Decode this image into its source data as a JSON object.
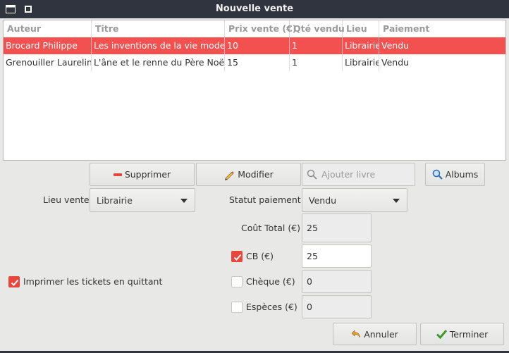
{
  "window": {
    "title": "Nouvelle vente"
  },
  "table": {
    "columns": [
      "Auteur",
      "Titre",
      "Prix vente (€)",
      "Qté vendu",
      "Lieu",
      "Paiement"
    ],
    "rows": [
      {
        "auteur": "Brocard Philippe",
        "titre": "Les inventions de la vie moderne",
        "prix": "10",
        "qte": "1",
        "lieu": "Librairie",
        "paiement": "Vendu",
        "selected": true
      },
      {
        "auteur": "Grenouiller Laureline",
        "titre": "L'âne et le renne du Père Noël",
        "prix": "15",
        "qte": "1",
        "lieu": "Librairie",
        "paiement": "Vendu",
        "selected": false
      }
    ]
  },
  "actions": {
    "supprimer": "Supprimer",
    "modifier": "Modifier",
    "search_placeholder": "Ajouter livre",
    "albums": "Albums"
  },
  "form": {
    "lieu_label": "Lieu vente",
    "lieu_value": "Librairie",
    "statut_label": "Statut paiement",
    "statut_value": "Vendu",
    "cout_label": "Coût Total (€)",
    "cout_value": "25",
    "cb_label": "CB (€)",
    "cb_value": "25",
    "cb_checked": true,
    "cheque_label": "Chèque (€)",
    "cheque_value": "0",
    "cheque_checked": false,
    "especes_label": "Espèces (€)",
    "especes_value": "0",
    "especes_checked": false,
    "print_label": "Imprimer les tickets en quittant",
    "print_checked": true
  },
  "footer": {
    "annuler": "Annuler",
    "terminer": "Terminer"
  },
  "colors": {
    "selection": "#f3514f",
    "accent": "#e8463d",
    "titlebar": "#2f343f"
  }
}
